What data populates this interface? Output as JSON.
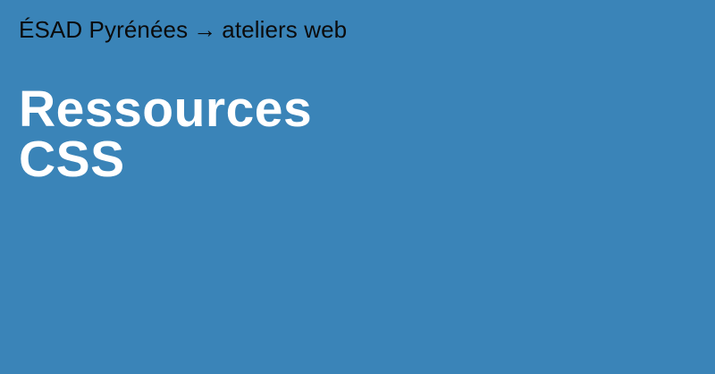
{
  "breadcrumb": {
    "school": "ÉSAD Pyrénées",
    "separator": "→",
    "section": "ateliers web"
  },
  "title": {
    "line1": "Ressources",
    "line2": "CSS"
  },
  "colors": {
    "background": "#3a84b8",
    "breadcrumb_text": "#0b0b0b",
    "title_text": "#ffffff"
  }
}
